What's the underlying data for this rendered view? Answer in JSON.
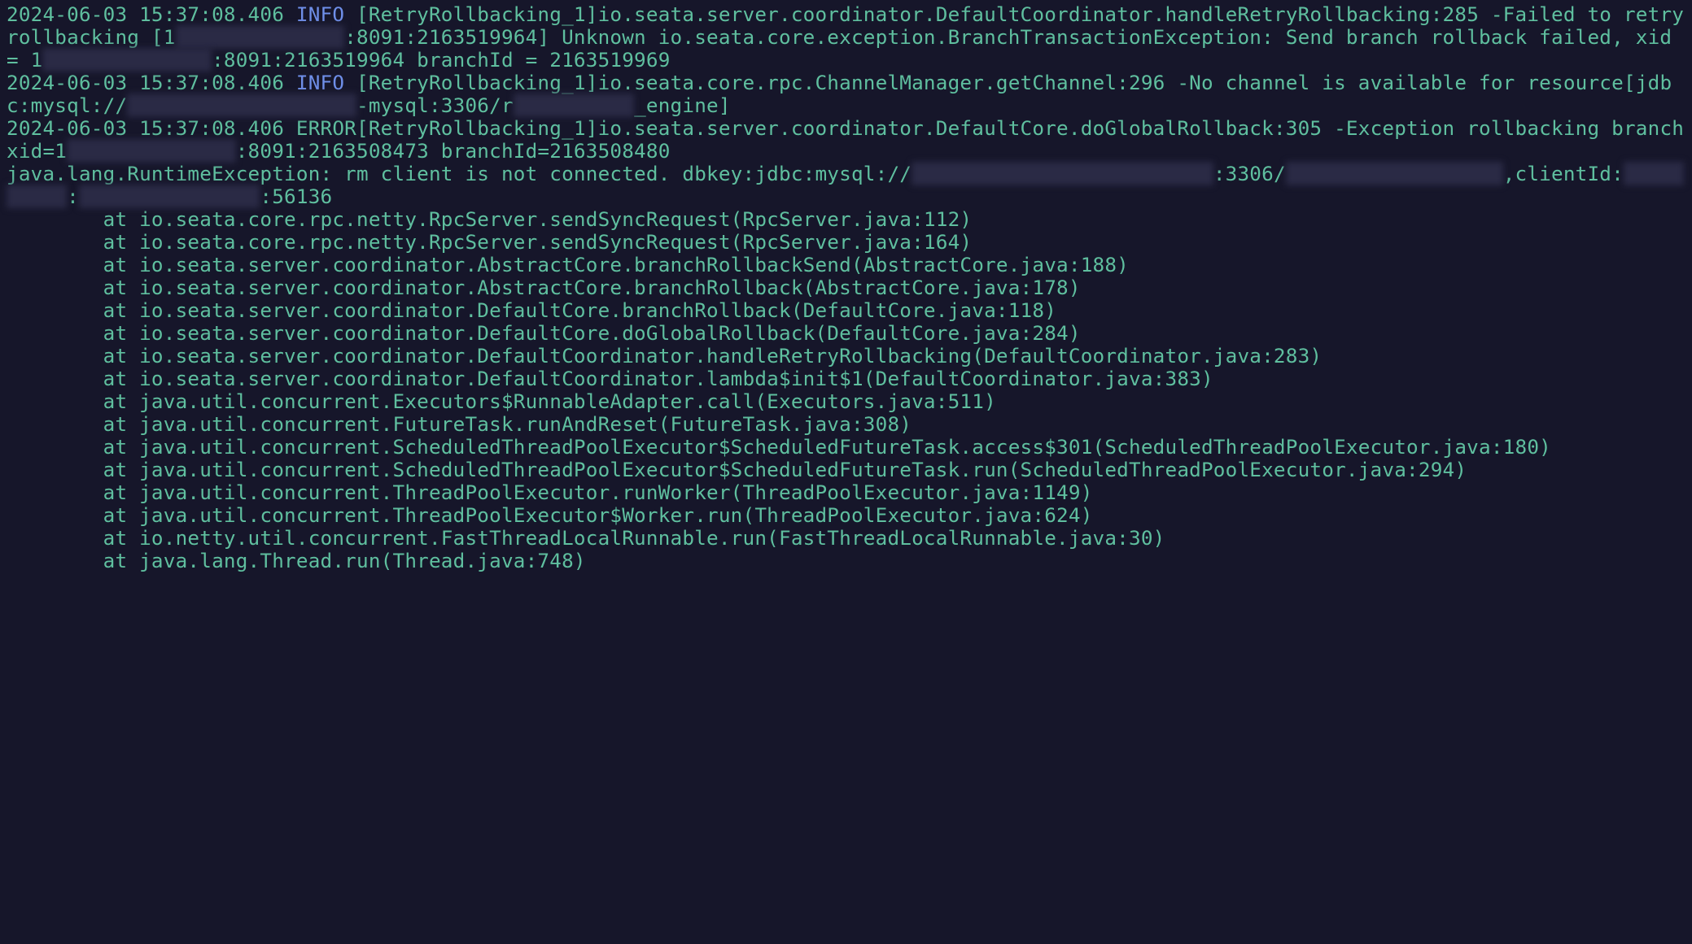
{
  "log": {
    "entries": [
      {
        "ts": "2024-06-03 15:37:08.406",
        "level": "INFO",
        "thread": "[RetryRollbacking_1]",
        "logger_a": "io.seata.server.coordinator.DefaultCoordinator.handleRetryRollbacking:285 -Failed to retry rollbacking [1",
        "redact_a": "XX.XXX.XXX.XXX",
        "logger_b": ":8091:2163519964] Unknown io.seata.core.exception.BranchTransactionException: Send branch rollback failed, xid = 1",
        "redact_b": "XX.XXX.XXX.XXX",
        "logger_c": ":8091:2163519964 branchId = 2163519969"
      },
      {
        "ts": "2024-06-03 15:37:08.406",
        "level": "INFO",
        "thread": "[RetryRollbacking_1]",
        "logger_a": "io.seata.core.rpc.ChannelManager.getChannel:296 -No channel is available for resource[jdbc:mysql://",
        "redact_a": "xxxxx-xxxx-xxxxx-xx",
        "logger_b": "-mysql:3306/r",
        "redact_b": "x_xxxxxxxx",
        "logger_c": "_engine]"
      },
      {
        "ts": "2024-06-03 15:37:08.406",
        "level": "ERROR",
        "thread": "[RetryRollbacking_1]",
        "logger_a": "io.seata.server.coordinator.DefaultCore.doGlobalRollback:305 -Exception rollbacking branch xid=1",
        "redact_a": "XX.XXX.XXX.XXX",
        "logger_b": ":8091:2163508473 branchId=2163508480"
      }
    ],
    "exception": {
      "head_a": "java.lang.RuntimeException: rm client is not connected. dbkey:jdbc:mysql://",
      "redact_a": "xxxxx-xxxx-xxxxx-xx-xxxxx",
      "head_b": ":3306/",
      "redact_b": "xx_xxxxxxxx_xxxxxx",
      "head_c": ",clientId:",
      "redact_c": "xxxxxxxxxx",
      "head_d": ":",
      "redact_d": "XXX.XXX.XXX.XXX",
      "head_e": ":56136",
      "stack": [
        "        at io.seata.core.rpc.netty.RpcServer.sendSyncRequest(RpcServer.java:112)",
        "        at io.seata.core.rpc.netty.RpcServer.sendSyncRequest(RpcServer.java:164)",
        "        at io.seata.server.coordinator.AbstractCore.branchRollbackSend(AbstractCore.java:188)",
        "        at io.seata.server.coordinator.AbstractCore.branchRollback(AbstractCore.java:178)",
        "        at io.seata.server.coordinator.DefaultCore.branchRollback(DefaultCore.java:118)",
        "        at io.seata.server.coordinator.DefaultCore.doGlobalRollback(DefaultCore.java:284)",
        "        at io.seata.server.coordinator.DefaultCoordinator.handleRetryRollbacking(DefaultCoordinator.java:283)",
        "        at io.seata.server.coordinator.DefaultCoordinator.lambda$init$1(DefaultCoordinator.java:383)",
        "        at java.util.concurrent.Executors$RunnableAdapter.call(Executors.java:511)",
        "        at java.util.concurrent.FutureTask.runAndReset(FutureTask.java:308)",
        "        at java.util.concurrent.ScheduledThreadPoolExecutor$ScheduledFutureTask.access$301(ScheduledThreadPoolExecutor.java:180)",
        "        at java.util.concurrent.ScheduledThreadPoolExecutor$ScheduledFutureTask.run(ScheduledThreadPoolExecutor.java:294)",
        "        at java.util.concurrent.ThreadPoolExecutor.runWorker(ThreadPoolExecutor.java:1149)",
        "        at java.util.concurrent.ThreadPoolExecutor$Worker.run(ThreadPoolExecutor.java:624)",
        "        at io.netty.util.concurrent.FastThreadLocalRunnable.run(FastThreadLocalRunnable.java:30)",
        "        at java.lang.Thread.run(Thread.java:748)"
      ]
    }
  }
}
